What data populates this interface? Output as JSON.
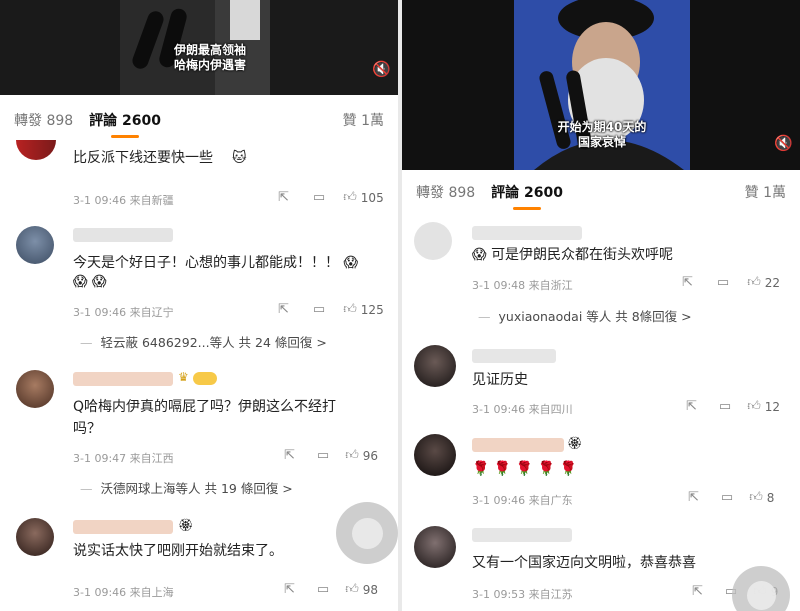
{
  "left": {
    "video_caption": [
      "伊朗最高领袖",
      "哈梅内伊遇害"
    ],
    "mute_icon": "speaker-mute-icon",
    "tabs": {
      "repost": "轉發 898",
      "comments": "評論 2600",
      "likes": "贊 1萬"
    },
    "comments": [
      {
        "text": "比反派下线还要快一些",
        "time": "3-1 09:46",
        "location": "来自新疆",
        "likes": "105"
      },
      {
        "text": "今天是个好日子！心想的事儿都能成！！！ 😱",
        "time": "3-1 09:46",
        "location": "来自辽宁",
        "likes": "125",
        "replies": "轻云蔽 6486292...等人 共 24 條回復 >"
      },
      {
        "text_line1": "Q哈梅内伊真的嗝屁了吗？伊朗这么不经打",
        "text_line2": "吗？",
        "time": "3-1 09:47",
        "location": "来自江西",
        "likes": "96",
        "replies": "沃德网球上海等人 共 19 條回復 >"
      },
      {
        "text": "说实话太快了吧刚开始就结束了。",
        "time": "3-1 09:46",
        "location": "来自上海",
        "likes": "98"
      }
    ]
  },
  "right": {
    "video_caption": [
      "开始为期40天的",
      "国家哀悼"
    ],
    "mute_icon": "speaker-mute-icon",
    "tabs": {
      "repost": "轉發 898",
      "comments": "評論 2600",
      "likes": "贊 1萬"
    },
    "comments": [
      {
        "text": "可是伊朗民众都在街头欢呼呢",
        "time": "3-1 09:48",
        "location": "来自浙江",
        "likes": "22",
        "replies": "yuxiaonaodai 等人 共 8條回復 >"
      },
      {
        "text": "见证历史",
        "time": "3-1 09:46",
        "location": "来自四川",
        "likes": "12"
      },
      {
        "text": "🌹 🌹 🌹 🌹 🌹",
        "time": "3-1 09:46",
        "location": "来自广东",
        "likes": "8"
      },
      {
        "text": "又有一个国家迈向文明啦，恭喜恭喜",
        "time": "3-1 09:53",
        "location": "来自江苏",
        "likes": "9"
      }
    ]
  },
  "colors": {
    "accent": "#ff8200",
    "meta": "#9a9a9a"
  },
  "icons": {
    "share": "share-icon",
    "comment": "comment-icon",
    "like": "thumbs-up-icon",
    "crown": "vip-crown-icon"
  }
}
